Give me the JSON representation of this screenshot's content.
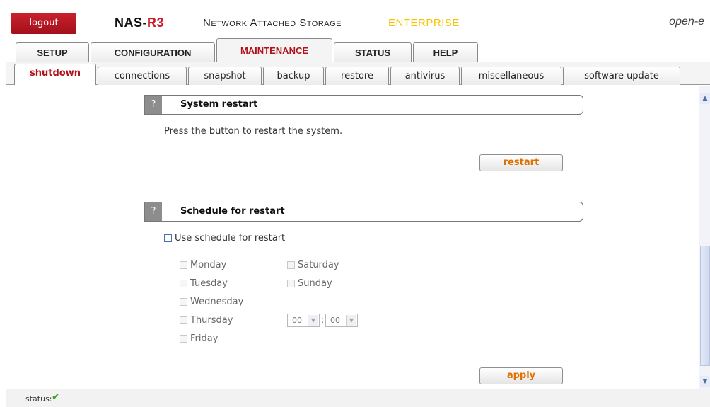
{
  "header": {
    "logout_label": "logout",
    "brand_prefix": "NAS-",
    "brand_accent": "R3",
    "brand_subtitle": "Network Attached Storage",
    "brand_edition": "ENTERPRISE",
    "vendor": "open-e"
  },
  "main_tabs": [
    {
      "label": "SETUP",
      "active": false
    },
    {
      "label": "CONFIGURATION",
      "active": false
    },
    {
      "label": "MAINTENANCE",
      "active": true
    },
    {
      "label": "STATUS",
      "active": false
    },
    {
      "label": "HELP",
      "active": false
    }
  ],
  "sub_tabs": [
    {
      "label": "shutdown",
      "active": true
    },
    {
      "label": "connections",
      "active": false
    },
    {
      "label": "snapshot",
      "active": false
    },
    {
      "label": "backup",
      "active": false
    },
    {
      "label": "restore",
      "active": false
    },
    {
      "label": "antivirus",
      "active": false
    },
    {
      "label": "miscellaneous",
      "active": false
    },
    {
      "label": "software update",
      "active": false
    }
  ],
  "restart_section": {
    "help_glyph": "?",
    "title": "System restart",
    "description": "Press the button to restart the system.",
    "button_label": "restart"
  },
  "schedule_section": {
    "help_glyph": "?",
    "title": "Schedule for restart",
    "use_schedule_label": "Use schedule for restart",
    "use_schedule_checked": false,
    "days": {
      "monday": "Monday",
      "tuesday": "Tuesday",
      "wednesday": "Wednesday",
      "thursday": "Thursday",
      "friday": "Friday",
      "saturday": "Saturday",
      "sunday": "Sunday"
    },
    "hour_value": "00",
    "minute_value": "00",
    "time_separator": ":",
    "apply_label": "apply"
  },
  "status_bar": {
    "label": "status:",
    "ok_glyph": "✔"
  },
  "colors": {
    "brand_red": "#cc1b26",
    "active_tab_text": "#b2111c",
    "button_text": "#e07000",
    "edition_yellow": "#f5c400",
    "status_ok": "#3aa022"
  }
}
